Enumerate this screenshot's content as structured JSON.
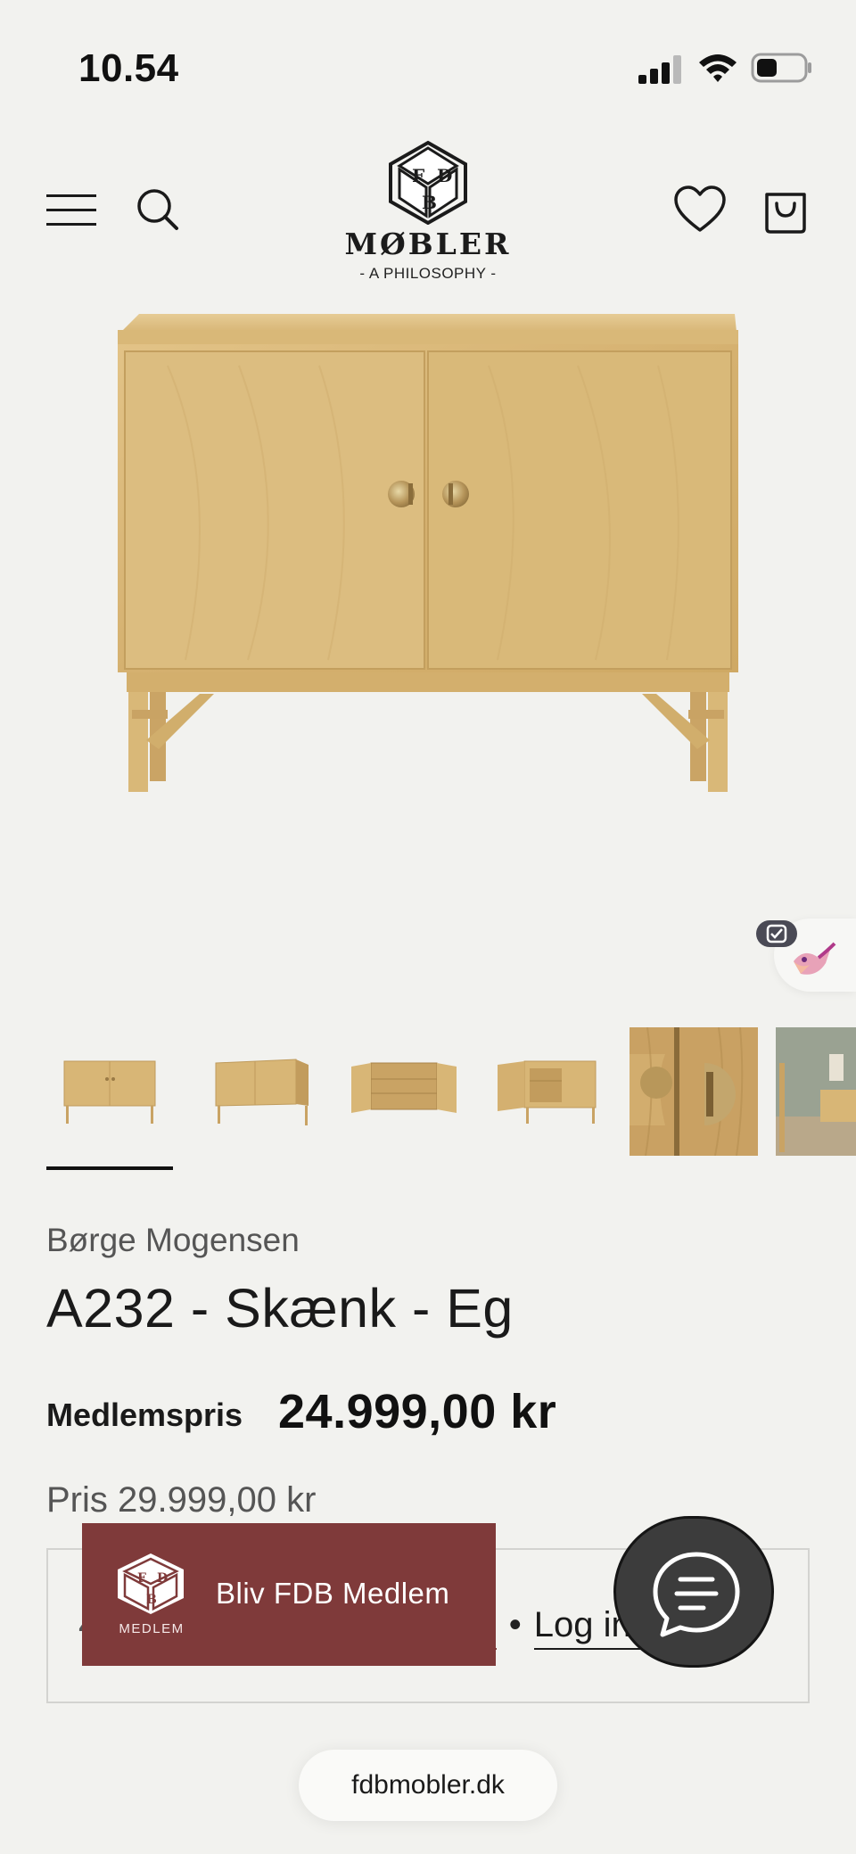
{
  "status_bar": {
    "time": "10.54",
    "signal_icon": "signal-icon",
    "wifi_icon": "wifi-icon",
    "battery_icon": "battery-icon"
  },
  "header": {
    "menu_icon": "menu-icon",
    "search_icon": "search-icon",
    "wishlist_icon": "heart-icon",
    "cart_icon": "bag-icon",
    "logo": {
      "mark_letters": [
        "F",
        "D",
        "B"
      ],
      "name": "MØBLER",
      "tagline": "- A PHILOSOPHY -"
    }
  },
  "hero": {
    "image": "A232 sideboard in oak, front view",
    "widget_icon": "bird-icon"
  },
  "thumbnails": [
    {
      "label": "front",
      "selected": true
    },
    {
      "label": "angled",
      "selected": false
    },
    {
      "label": "open-doors",
      "selected": false
    },
    {
      "label": "open-angled",
      "selected": false
    },
    {
      "label": "handle-detail",
      "selected": false
    },
    {
      "label": "interior",
      "selected": false
    }
  ],
  "product": {
    "designer": "Børge Mogensen",
    "title": "A232 - Skænk - Eg",
    "member_price_label": "Medlemspris",
    "member_price": "24.999,00 kr",
    "regular_price": "Pris 29.999,00 kr"
  },
  "membership_box": {
    "leading_char": "4",
    "become_member_link": "dlem",
    "separator": "•",
    "login_link": "Log ind"
  },
  "fdb_banner": {
    "title": "Bliv FDB Medlem",
    "logo_caption": "MEDLEM"
  },
  "chat": {
    "icon": "chat-icon"
  },
  "browser": {
    "url": "fdbmobler.dk"
  },
  "colors": {
    "background": "#f2f2ef",
    "brand_red": "#7f3a3a",
    "oak": "#d8b676",
    "text": "#1d1d1d"
  }
}
